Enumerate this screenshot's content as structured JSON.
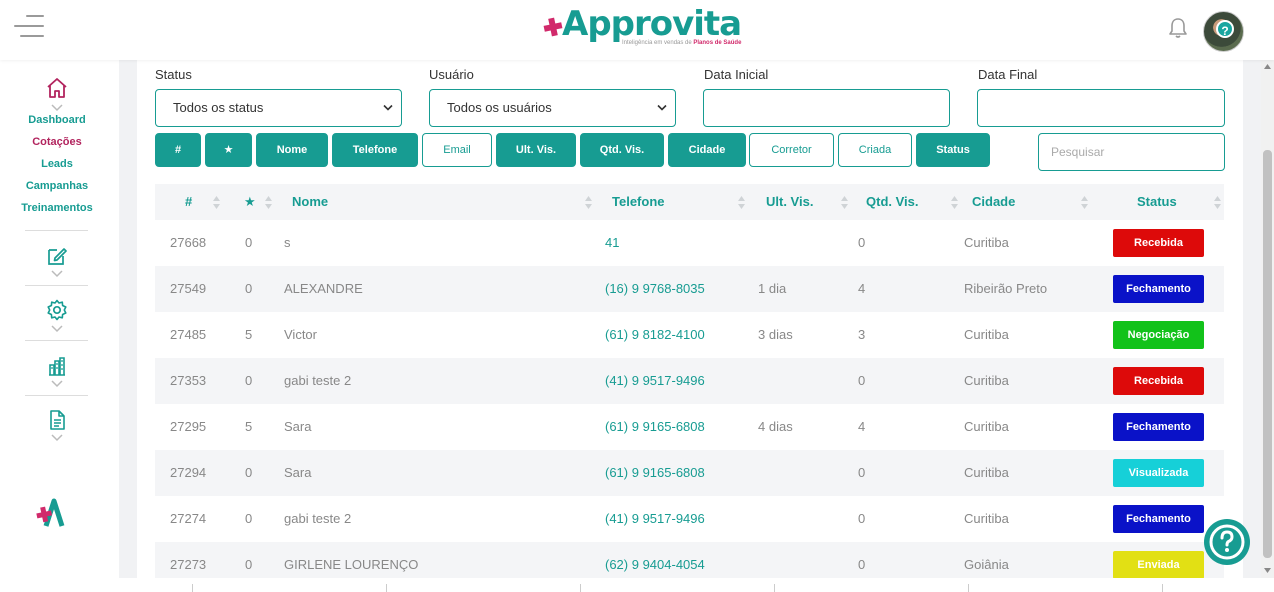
{
  "brand": {
    "name": "Approvita",
    "tagline_prefix": "Inteligência em vendas de",
    "tagline_highlight": "Planos de Saúde",
    "accent": "#179c92",
    "pink": "#d12a6b"
  },
  "sidebar": {
    "links": [
      {
        "label": "Dashboard",
        "active": false
      },
      {
        "label": "Cotações",
        "active": true
      },
      {
        "label": "Leads",
        "active": false
      },
      {
        "label": "Campanhas",
        "active": false
      },
      {
        "label": "Treinamentos",
        "active": false
      }
    ],
    "icons": [
      "edit-icon",
      "gear-icon",
      "chart-icon",
      "document-icon"
    ]
  },
  "filters": {
    "status": {
      "label": "Status",
      "value": "Todos os status"
    },
    "user": {
      "label": "Usuário",
      "value": "Todos os usuários"
    },
    "start_date": {
      "label": "Data Inicial",
      "value": ""
    },
    "end_date": {
      "label": "Data Final",
      "value": ""
    }
  },
  "column_toggles": [
    {
      "label": "#",
      "on": true
    },
    {
      "label": "★",
      "on": true
    },
    {
      "label": "Nome",
      "on": true
    },
    {
      "label": "Telefone",
      "on": true
    },
    {
      "label": "Email",
      "on": false
    },
    {
      "label": "Ult. Vis.",
      "on": true
    },
    {
      "label": "Qtd. Vis.",
      "on": true
    },
    {
      "label": "Cidade",
      "on": true
    },
    {
      "label": "Corretor",
      "on": false
    },
    {
      "label": "Criada",
      "on": false
    },
    {
      "label": "Status",
      "on": true
    }
  ],
  "search": {
    "placeholder": "Pesquisar"
  },
  "table": {
    "headers": [
      "#",
      "★",
      "Nome",
      "Telefone",
      "Ult. Vis.",
      "Qtd. Vis.",
      "Cidade",
      "Status"
    ],
    "rows": [
      {
        "id": "27668",
        "stars": "0",
        "name": "s",
        "phone": "41",
        "last_visit": "",
        "visits": "0",
        "city": "Curitiba",
        "status": "Recebida",
        "status_color": "#dd0a0a"
      },
      {
        "id": "27549",
        "stars": "0",
        "name": "ALEXANDRE",
        "phone": "(16) 9 9768-8035",
        "last_visit": "1 dia",
        "visits": "4",
        "city": "Ribeirão Preto",
        "status": "Fechamento",
        "status_color": "#0a12c8"
      },
      {
        "id": "27485",
        "stars": "5",
        "name": "Victor",
        "phone": "(61) 9 8182-4100",
        "last_visit": "3 dias",
        "visits": "3",
        "city": "Curitiba",
        "status": "Negociação",
        "status_color": "#12c21a"
      },
      {
        "id": "27353",
        "stars": "0",
        "name": "gabi teste 2",
        "phone": "(41) 9 9517-9496",
        "last_visit": "",
        "visits": "0",
        "city": "Curitiba",
        "status": "Recebida",
        "status_color": "#dd0a0a"
      },
      {
        "id": "27295",
        "stars": "5",
        "name": "Sara",
        "phone": "(61) 9 9165-6808",
        "last_visit": "4 dias",
        "visits": "4",
        "city": "Curitiba",
        "status": "Fechamento",
        "status_color": "#0a12c8"
      },
      {
        "id": "27294",
        "stars": "0",
        "name": "Sara",
        "phone": "(61) 9 9165-6808",
        "last_visit": "",
        "visits": "0",
        "city": "Curitiba",
        "status": "Visualizada",
        "status_color": "#16d0d8"
      },
      {
        "id": "27274",
        "stars": "0",
        "name": "gabi teste 2",
        "phone": "(41) 9 9517-9496",
        "last_visit": "",
        "visits": "0",
        "city": "Curitiba",
        "status": "Fechamento",
        "status_color": "#0a12c8"
      },
      {
        "id": "27273",
        "stars": "0",
        "name": "GIRLENE LOURENÇO",
        "phone": "(62) 9 9404-4054",
        "last_visit": "",
        "visits": "0",
        "city": "Goiânia",
        "status": "Enviada",
        "status_color": "#e2e014"
      }
    ]
  }
}
